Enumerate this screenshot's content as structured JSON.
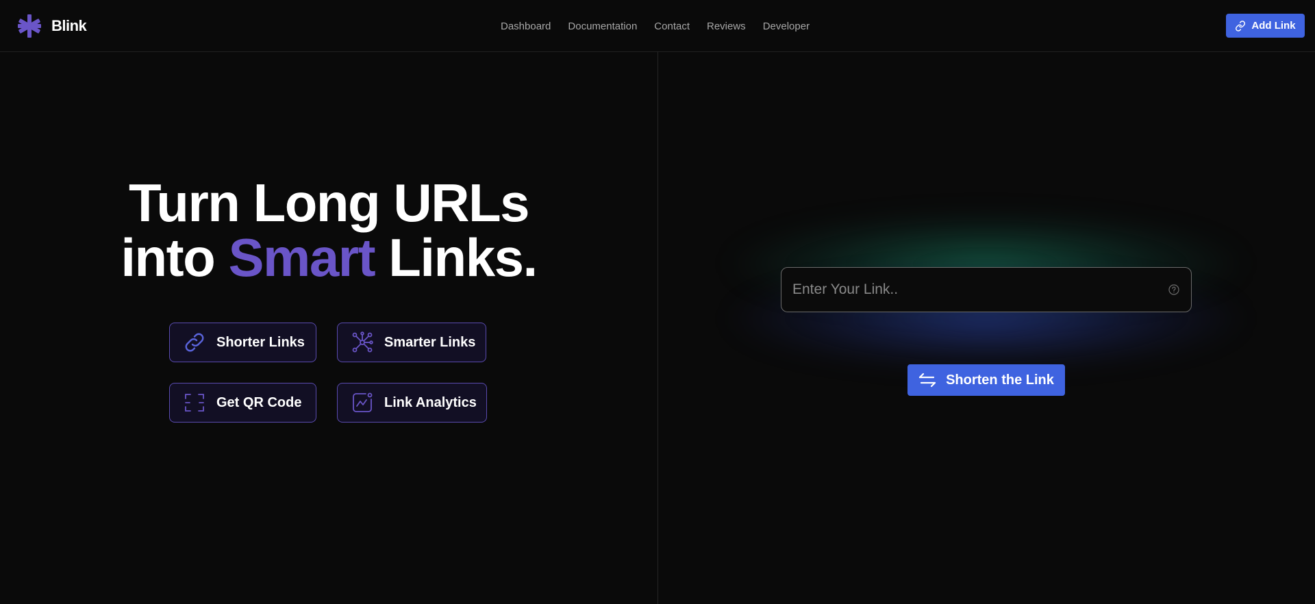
{
  "header": {
    "brand_name": "Blink",
    "logo_icon": "asterisk-icon",
    "nav": [
      "Dashboard",
      "Documentation",
      "Contact",
      "Reviews",
      "Developer"
    ],
    "add_link_label": "Add Link",
    "add_link_icon": "link-icon"
  },
  "hero": {
    "line1": "Turn Long URLs",
    "line2_prefix": "into",
    "line2_accent": "Smart",
    "line2_suffix": "Links.",
    "accent_color": "#6a55c8"
  },
  "features": [
    {
      "label": "Shorter Links",
      "icon": "link-icon"
    },
    {
      "label": "Smarter Links",
      "icon": "network-icon"
    },
    {
      "label": "Get QR Code",
      "icon": "qr-scan-icon"
    },
    {
      "label": "Link Analytics",
      "icon": "analytics-icon"
    }
  ],
  "shortener": {
    "input_placeholder": "Enter Your Link..",
    "input_value": "",
    "help_icon": "question-circle-icon",
    "button_label": "Shorten the Link",
    "button_icon": "swap-arrows-icon"
  },
  "colors": {
    "background": "#0a0a0a",
    "primary": "#3f63e0",
    "accent_purple": "#6a55c8"
  }
}
